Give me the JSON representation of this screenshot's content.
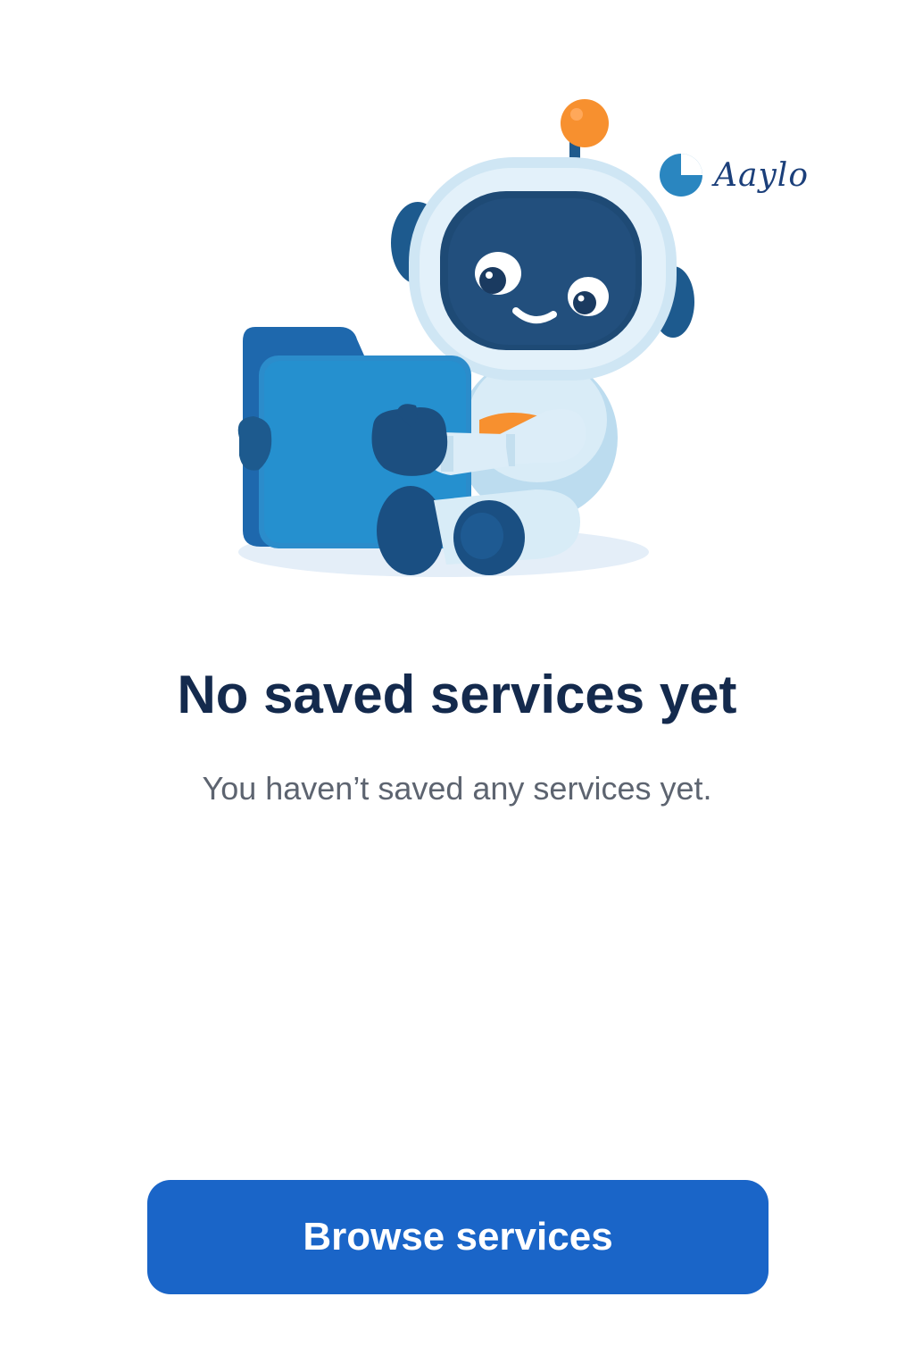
{
  "brand": {
    "name": "Aaylo",
    "logo_icon": "pie-chart-icon",
    "color": "#1b3f7a"
  },
  "illustration": {
    "subject": "robot-holding-folder-icon"
  },
  "empty_state": {
    "title": "No saved services yet",
    "message": "You haven’t saved any services yet."
  },
  "actions": {
    "browse_label": "Browse services"
  },
  "colors": {
    "primary_button": "#1a65c8",
    "title_text": "#142a4d",
    "body_text": "#5d6470",
    "accent_orange": "#f7902f",
    "robot_dark": "#1c4c7c"
  }
}
